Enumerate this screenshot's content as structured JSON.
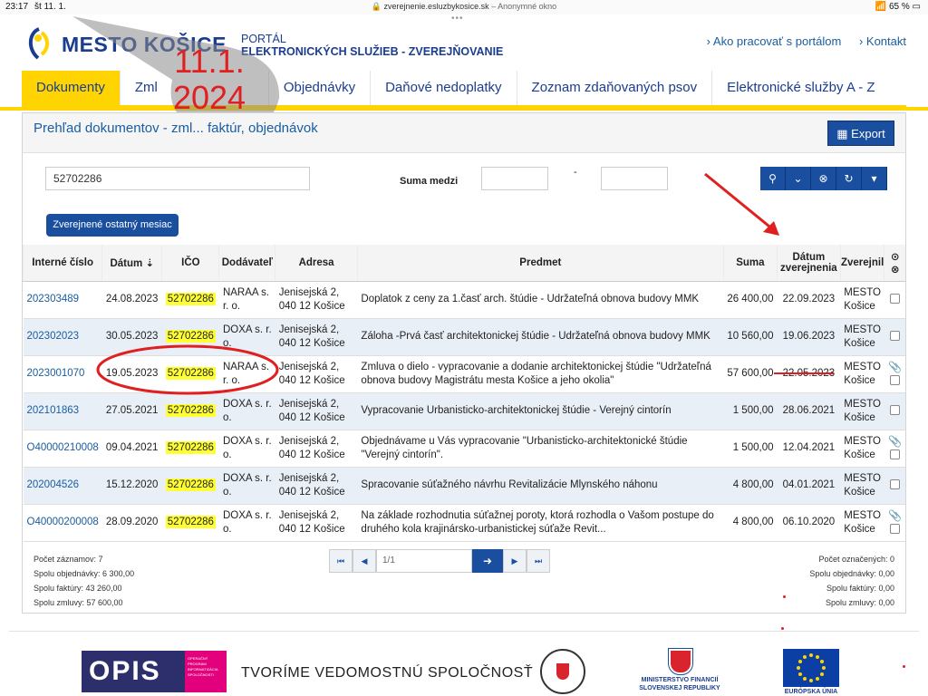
{
  "statusbar": {
    "time": "23:17",
    "date": "št 11. 1.",
    "host": "zverejnenie.esluzbykosice.sk",
    "mode": "– Anonymné okno",
    "battery": "65 %"
  },
  "header": {
    "brand": "MESTO KOŠICE",
    "portal_line1": "PORTÁL",
    "portal_line2": "ELEKTRONICKÝCH SLUŽIEB - ZVEREJŇOVANIE",
    "nav_how": "› Ako pracovať s portálom",
    "nav_contact": "› Kontakt",
    "overlay_date_line1": "11.1.",
    "overlay_date_line2": "2024"
  },
  "tabs": [
    {
      "label": "Dokumenty"
    },
    {
      "label": "Zml"
    },
    {
      "label": "Objednávky"
    },
    {
      "label": "Daňové nedoplatky"
    },
    {
      "label": "Zoznam zdaňovaných psov"
    },
    {
      "label": "Elektronické služby A - Z"
    }
  ],
  "panel": {
    "title": "Prehľad dokumentov - zml... faktúr, objednávok",
    "export_label": "Export",
    "search_value": "52702286",
    "suma_label": "Suma medzi",
    "suma_dash": "-",
    "month_button": "Zverejnené ostatný mesiac"
  },
  "icons": {
    "export": "export-icon",
    "search": "search-icon",
    "down": "chevron-down-icon",
    "clear": "clear-icon",
    "refresh": "refresh-icon",
    "caret": "caret-down-icon",
    "attachment": "paperclip-icon"
  },
  "table": {
    "headers": [
      "Interné číslo",
      "Dátum",
      "IČO",
      "Dodávateľ",
      "Adresa",
      "Predmet",
      "Suma",
      "Dátum zverejnenia",
      "Zverejnil"
    ],
    "rows": [
      {
        "id": "202303489",
        "date": "24.08.2023",
        "ico": "52702286",
        "supplier": "NARAA s. r. o.",
        "address": "Jenisejská 2, 040 12 Košice",
        "subject": "Doplatok z ceny za 1.časť arch. štúdie - Udržateľná obnova budovy MMK",
        "sum": "26 400,00",
        "published": "22.09.2023",
        "by": "MESTO Košice",
        "clip": false
      },
      {
        "id": "202302023",
        "date": "30.05.2023",
        "ico": "52702286",
        "supplier": "DOXA s. r. o.",
        "address": "Jenisejská 2, 040 12 Košice",
        "subject": "Záloha -Prvá časť architektonickej štúdie - Udržateľná obnova budovy MMK",
        "sum": "10 560,00",
        "published": "19.06.2023",
        "by": "MESTO Košice",
        "clip": false
      },
      {
        "id": "2023001070",
        "date": "19.05.2023",
        "ico": "52702286",
        "supplier": "NARAA s. r. o.",
        "address": "Jenisejská 2, 040 12 Košice",
        "subject": "Zmluva o dielo - vypracovanie a dodanie architektonickej štúdie \"Udržateľná obnova budovy Magistrátu mesta Košice a jeho okolia\"",
        "sum": "57 600,00",
        "published": "22.05.2023",
        "by": "MESTO Košice",
        "clip": true
      },
      {
        "id": "202101863",
        "date": "27.05.2021",
        "ico": "52702286",
        "supplier": "DOXA s. r. o.",
        "address": "Jenisejská 2, 040 12 Košice",
        "subject": "Vypracovanie Urbanisticko-architektonickej štúdie - Verejný cintorín",
        "sum": "1 500,00",
        "published": "28.06.2021",
        "by": "MESTO Košice",
        "clip": false
      },
      {
        "id": "O40000210008",
        "date": "09.04.2021",
        "ico": "52702286",
        "supplier": "DOXA s. r. o.",
        "address": "Jenisejská 2, 040 12 Košice",
        "subject": "Objednávame u Vás vypracovanie \"Urbanisticko-architektonické štúdie \"Verejný cintorín\".",
        "sum": "1 500,00",
        "published": "12.04.2021",
        "by": "MESTO Košice",
        "clip": true
      },
      {
        "id": "202004526",
        "date": "15.12.2020",
        "ico": "52702286",
        "supplier": "DOXA s. r. o.",
        "address": "Jenisejská 2, 040 12 Košice",
        "subject": "Spracovanie súťažného návrhu Revitalizácie Mlynského náhonu",
        "sum": "4 800,00",
        "published": "04.01.2021",
        "by": "MESTO Košice",
        "clip": false
      },
      {
        "id": "O40000200008",
        "date": "28.09.2020",
        "ico": "52702286",
        "supplier": "DOXA s. r. o.",
        "address": "Jenisejská 2, 040 12 Košice",
        "subject": "Na základe rozhodnutia súťažnej poroty, ktorá rozhodla o Vašom postupe do druhého kola krajinársko-urbanistickej súťaže Revit...",
        "sum": "4 800,00",
        "published": "06.10.2020",
        "by": "MESTO Košice",
        "clip": true
      }
    ]
  },
  "footer": {
    "records": "Počet záznamov: 7",
    "orders": "Spolu objednávky: 6 300,00",
    "invoices": "Spolu faktúry: 43 260,00",
    "contracts": "Spolu zmluvy: 57 600,00",
    "marked": "Počet označených: 0",
    "marked_orders": "Spolu objednávky: 0,00",
    "marked_invoices": "Spolu faktúry: 0,00",
    "marked_contracts": "Spolu zmluvy: 0,00",
    "page": "1/1"
  },
  "sponsors": {
    "opis": "OPIS",
    "opis_small": "OPERAČNÝ PROGRAM INFORMATIZÁCIA SPOLOČNOSTI",
    "slogan": "TVORÍME VEDOMOSTNÚ SPOLOČNOSŤ",
    "ministry": "MINISTERSTVO FINANCIÍ SLOVENSKEJ REPUBLIKY",
    "eu": "EURÓPSKA ÚNIA"
  },
  "colors": {
    "accent": "#ffd400",
    "brand": "#1a3d8f",
    "button": "#1a4fa0",
    "annotation": "#e02020",
    "highlight": "#ffff33"
  }
}
